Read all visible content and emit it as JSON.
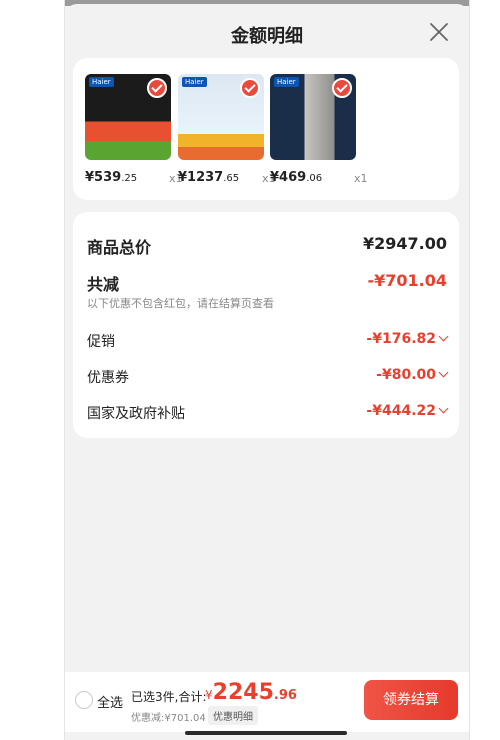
{
  "header": {
    "title": "金额明细",
    "close_icon": "close-icon"
  },
  "products": [
    {
      "price_int": "¥539",
      "price_dec": ".25",
      "qty": "x1",
      "brand": "Haier",
      "thumb_colors": [
        "#1b1b1b",
        "#e8512f",
        "#5aa532"
      ]
    },
    {
      "price_int": "¥1237",
      "price_dec": ".65",
      "qty": "x1",
      "brand": "Haier",
      "thumb_colors": [
        "#dde7f2",
        "#e8f3fb",
        "#f0b329"
      ]
    },
    {
      "price_int": "¥469",
      "price_dec": ".06",
      "qty": "x1",
      "brand": "Haier",
      "thumb_colors": [
        "#1a2e49",
        "#c7c6c3",
        "#3a3a3a"
      ]
    }
  ],
  "summary": {
    "goods_total_label": "商品总价",
    "goods_total_value": "¥2947.00",
    "reduction_label": "共减",
    "reduction_value": "-¥701.04",
    "reduction_note": "以下优惠不包含红包，请在结算页查看",
    "promo_label": "促销",
    "promo_value": "-¥176.82",
    "coupon_label": "优惠券",
    "coupon_value": "-¥80.00",
    "subsidy_label": "国家及政府补贴",
    "subsidy_value": "-¥444.22"
  },
  "footer": {
    "select_all_label": "全选",
    "selected_text": "已选3件,合计:",
    "total_currency": "¥",
    "total_int": "2245",
    "total_dec": ".96",
    "discount_text": "优惠减:¥701.04",
    "detail_button_label": "优惠明细",
    "checkout_button_label": "领券结算"
  },
  "colors": {
    "accent": "#e8402f",
    "background": "#f2f2f2"
  }
}
